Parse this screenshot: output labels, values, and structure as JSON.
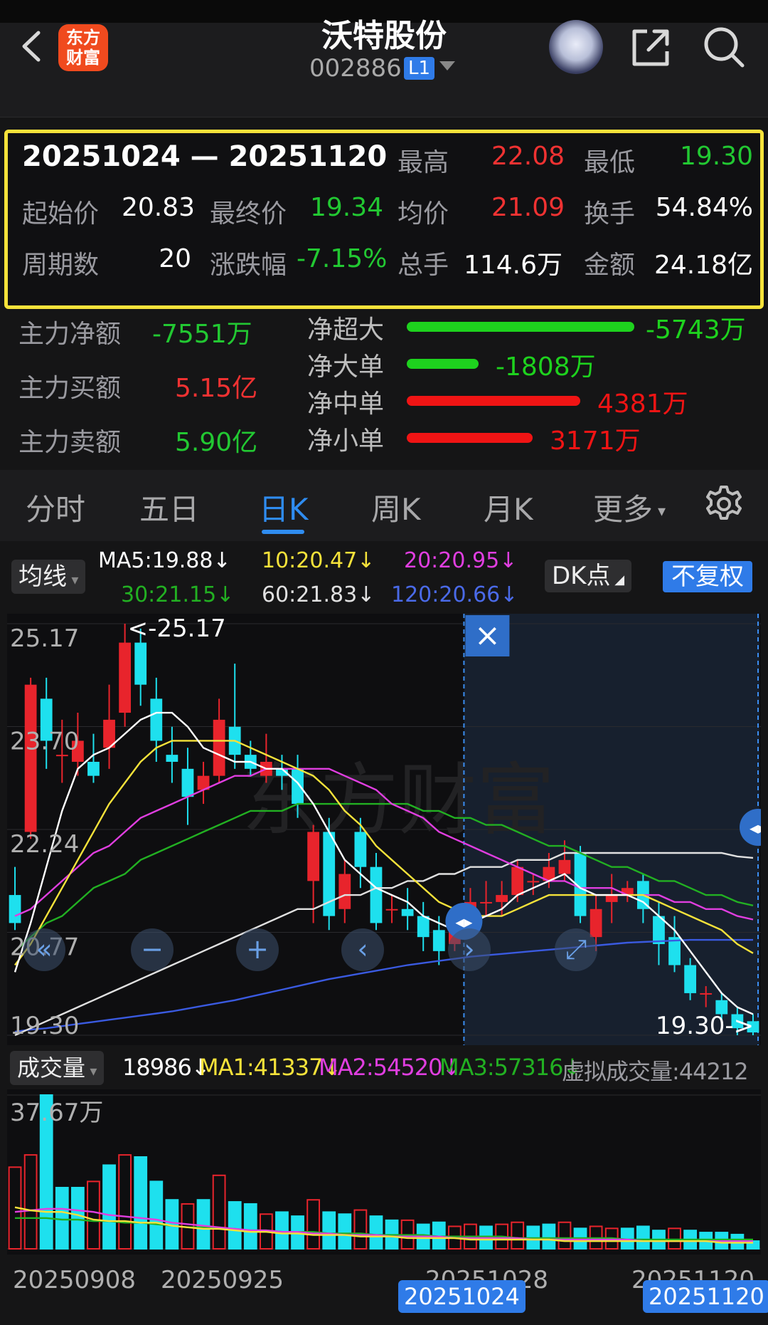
{
  "header": {
    "logo_line1": "东方",
    "logo_line2": "财富",
    "title": "沃特股份",
    "code": "002886",
    "level_badge": "L1"
  },
  "summary": {
    "range": "20251024 — 20251120",
    "high_label": "最高",
    "high": "22.08",
    "low_label": "最低",
    "low": "19.30",
    "open_label": "起始价",
    "open": "20.83",
    "close_label": "最终价",
    "close": "19.34",
    "avg_label": "均价",
    "avg": "21.09",
    "turnover_label": "换手",
    "turnover": "54.84%",
    "periods_label": "周期数",
    "periods": "20",
    "change_label": "涨跌幅",
    "change": "-7.15%",
    "volume_label": "总手",
    "volume": "114.6万",
    "amount_label": "金额",
    "amount": "24.18亿"
  },
  "flow": {
    "main_net_label": "主力净额",
    "main_net": "-7551万",
    "main_buy_label": "主力买额",
    "main_buy": "5.15亿",
    "main_sell_label": "主力卖额",
    "main_sell": "5.90亿",
    "items": [
      {
        "label": "净超大",
        "value": "-5743万",
        "amount": -5743,
        "color": "#1ed21e"
      },
      {
        "label": "净大单",
        "value": "-1808万",
        "amount": -1808,
        "color": "#1ed21e"
      },
      {
        "label": "净中单",
        "value": "4381万",
        "amount": 4381,
        "color": "#f01414"
      },
      {
        "label": "净小单",
        "value": "3171万",
        "amount": 3171,
        "color": "#f01414"
      }
    ]
  },
  "tabs": [
    "分时",
    "五日",
    "日K",
    "周K",
    "月K",
    "更多"
  ],
  "active_tab": "日K",
  "ma_legend": {
    "chip": "均线",
    "ma5": "MA5:19.88↓",
    "ma10": "10:20.47↓",
    "ma20": "20:20.95↓",
    "ma30": "30:21.15↓",
    "ma60": "60:21.83↓",
    "ma120": "120:20.66↓",
    "dk_chip": "DK点",
    "fq_button": "不复权",
    "colors": {
      "ma5": "#ffffff",
      "ma10": "#f5e23a",
      "ma20": "#e03ee0",
      "ma30": "#22b022",
      "ma60": "#e0e0e0",
      "ma120": "#3a5ae0"
    }
  },
  "kline": {
    "y_labels": [
      "25.17",
      "23.70",
      "22.24",
      "20.77",
      "19.30"
    ],
    "max_annotation": "<-25.17",
    "min_annotation": "19.30->",
    "close_icon": "×",
    "ylim": [
      19.3,
      25.17
    ]
  },
  "volume": {
    "chip": "成交量",
    "value": "18986↓",
    "ma1": "MA1:41337↓",
    "ma2": "MA2:54520↓",
    "ma3": "MA3:57316↓",
    "virtual": "虚拟成交量:44212",
    "top_label": "37.67万",
    "max": 376700
  },
  "x_dates": [
    "20250908",
    "20250925",
    "20251028",
    "20251120"
  ],
  "selected_start": "20251024",
  "selected_end": "20251120",
  "chart_data": {
    "type": "candlestick",
    "ylim": [
      19.3,
      25.17
    ],
    "candles": [
      {
        "o": 21.3,
        "c": 20.9,
        "h": 21.7,
        "l": 20.8
      },
      {
        "o": 22.2,
        "c": 24.3,
        "h": 24.4,
        "l": 22.1
      },
      {
        "o": 24.1,
        "c": 23.5,
        "h": 24.4,
        "l": 23.1
      },
      {
        "o": 23.3,
        "c": 23.3,
        "h": 23.8,
        "l": 22.9
      },
      {
        "o": 23.2,
        "c": 23.5,
        "h": 23.9,
        "l": 23.0
      },
      {
        "o": 23.2,
        "c": 23.0,
        "h": 23.6,
        "l": 22.9
      },
      {
        "o": 23.4,
        "c": 23.8,
        "h": 24.3,
        "l": 23.1
      },
      {
        "o": 23.9,
        "c": 24.9,
        "h": 25.17,
        "l": 23.7
      },
      {
        "o": 24.9,
        "c": 24.3,
        "h": 25.1,
        "l": 24.0
      },
      {
        "o": 24.1,
        "c": 23.5,
        "h": 24.4,
        "l": 23.2
      },
      {
        "o": 23.3,
        "c": 23.2,
        "h": 23.7,
        "l": 22.9
      },
      {
        "o": 23.1,
        "c": 22.7,
        "h": 23.4,
        "l": 22.3
      },
      {
        "o": 22.8,
        "c": 23.0,
        "h": 23.2,
        "l": 22.6
      },
      {
        "o": 23.0,
        "c": 23.8,
        "h": 24.1,
        "l": 22.9
      },
      {
        "o": 23.7,
        "c": 23.3,
        "h": 24.6,
        "l": 23.1
      },
      {
        "o": 23.3,
        "c": 23.1,
        "h": 23.5,
        "l": 23.0
      },
      {
        "o": 23.0,
        "c": 23.2,
        "h": 23.6,
        "l": 22.9
      },
      {
        "o": 23.1,
        "c": 23.0,
        "h": 23.3,
        "l": 22.8
      },
      {
        "o": 23.1,
        "c": 22.6,
        "h": 23.3,
        "l": 22.4
      },
      {
        "o": 21.5,
        "c": 22.2,
        "h": 22.3,
        "l": 20.9
      },
      {
        "o": 22.2,
        "c": 21.0,
        "h": 22.4,
        "l": 20.8
      },
      {
        "o": 21.1,
        "c": 21.6,
        "h": 21.8,
        "l": 20.9
      },
      {
        "o": 22.2,
        "c": 21.7,
        "h": 22.4,
        "l": 21.4
      },
      {
        "o": 21.7,
        "c": 20.9,
        "h": 21.9,
        "l": 20.8
      },
      {
        "o": 21.1,
        "c": 21.1,
        "h": 21.3,
        "l": 20.9
      },
      {
        "o": 21.1,
        "c": 21.0,
        "h": 21.4,
        "l": 20.8
      },
      {
        "o": 21.0,
        "c": 20.7,
        "h": 21.2,
        "l": 20.5
      },
      {
        "o": 20.8,
        "c": 20.5,
        "h": 21.0,
        "l": 20.3
      },
      {
        "o": 20.6,
        "c": 20.8,
        "h": 21.0,
        "l": 20.5
      },
      {
        "o": 21.1,
        "c": 21.2,
        "h": 21.4,
        "l": 20.9
      },
      {
        "o": 21.2,
        "c": 21.2,
        "h": 21.5,
        "l": 21.0
      },
      {
        "o": 21.2,
        "c": 21.3,
        "h": 21.5,
        "l": 21.0
      },
      {
        "o": 21.3,
        "c": 21.7,
        "h": 21.8,
        "l": 21.2
      },
      {
        "o": 21.5,
        "c": 21.5,
        "h": 21.6,
        "l": 21.3
      },
      {
        "o": 21.5,
        "c": 21.7,
        "h": 21.9,
        "l": 21.4
      },
      {
        "o": 21.6,
        "c": 21.8,
        "h": 22.08,
        "l": 21.5
      },
      {
        "o": 21.9,
        "c": 21.0,
        "h": 22.0,
        "l": 20.9
      },
      {
        "o": 20.7,
        "c": 21.1,
        "h": 21.3,
        "l": 20.5
      },
      {
        "o": 21.2,
        "c": 21.3,
        "h": 21.6,
        "l": 20.9
      },
      {
        "o": 21.3,
        "c": 21.4,
        "h": 21.5,
        "l": 21.2
      },
      {
        "o": 21.5,
        "c": 21.1,
        "h": 21.6,
        "l": 20.9
      },
      {
        "o": 21.0,
        "c": 20.6,
        "h": 21.2,
        "l": 20.3
      },
      {
        "o": 20.7,
        "c": 20.3,
        "h": 21.0,
        "l": 20.2
      },
      {
        "o": 20.3,
        "c": 19.9,
        "h": 20.4,
        "l": 19.8
      },
      {
        "o": 19.9,
        "c": 19.9,
        "h": 20.0,
        "l": 19.7
      },
      {
        "o": 19.8,
        "c": 19.6,
        "h": 19.9,
        "l": 19.5
      },
      {
        "o": 19.6,
        "c": 19.4,
        "h": 19.7,
        "l": 19.3
      },
      {
        "o": 19.5,
        "c": 19.34,
        "h": 19.6,
        "l": 19.3
      }
    ],
    "ma5": [
      20.2,
      20.9,
      21.7,
      22.5,
      23.1,
      23.3,
      23.4,
      23.6,
      23.8,
      23.9,
      23.9,
      23.7,
      23.4,
      23.3,
      23.2,
      23.2,
      23.1,
      23.1,
      22.9,
      22.6,
      22.2,
      21.8,
      21.6,
      21.4,
      21.3,
      21.2,
      21.0,
      20.9,
      20.8,
      20.9,
      21.0,
      21.1,
      21.3,
      21.4,
      21.5,
      21.6,
      21.4,
      21.3,
      21.3,
      21.3,
      21.2,
      21.0,
      20.8,
      20.5,
      20.2,
      19.9,
      19.7,
      19.6
    ],
    "ma10": [
      20.3,
      20.6,
      21.0,
      21.4,
      21.8,
      22.2,
      22.6,
      22.9,
      23.2,
      23.4,
      23.5,
      23.5,
      23.5,
      23.5,
      23.5,
      23.4,
      23.3,
      23.2,
      23.1,
      23.0,
      22.8,
      22.5,
      22.3,
      22.0,
      21.8,
      21.6,
      21.4,
      21.2,
      21.1,
      21.0,
      21.0,
      21.0,
      21.1,
      21.2,
      21.3,
      21.3,
      21.3,
      21.3,
      21.3,
      21.3,
      21.3,
      21.2,
      21.1,
      21.0,
      20.9,
      20.8,
      20.6,
      20.47
    ],
    "ma20": [
      21.0,
      21.1,
      21.3,
      21.5,
      21.7,
      21.9,
      22.0,
      22.2,
      22.4,
      22.5,
      22.6,
      22.7,
      22.8,
      22.9,
      23.0,
      23.0,
      23.1,
      23.1,
      23.1,
      23.1,
      23.1,
      23.0,
      22.9,
      22.8,
      22.6,
      22.5,
      22.4,
      22.2,
      22.1,
      22.0,
      21.9,
      21.8,
      21.7,
      21.6,
      21.5,
      21.5,
      21.4,
      21.4,
      21.4,
      21.3,
      21.3,
      21.3,
      21.2,
      21.2,
      21.1,
      21.1,
      21.0,
      20.95
    ],
    "ma30": [
      20.5,
      20.7,
      20.9,
      21.0,
      21.2,
      21.4,
      21.5,
      21.6,
      21.8,
      21.9,
      22.0,
      22.1,
      22.2,
      22.3,
      22.4,
      22.5,
      22.5,
      22.5,
      22.6,
      22.6,
      22.6,
      22.6,
      22.6,
      22.6,
      22.6,
      22.6,
      22.5,
      22.5,
      22.4,
      22.4,
      22.3,
      22.3,
      22.2,
      22.1,
      22.0,
      22.0,
      21.9,
      21.8,
      21.7,
      21.7,
      21.6,
      21.5,
      21.5,
      21.4,
      21.3,
      21.3,
      21.2,
      21.15
    ],
    "ma60": [
      19.3,
      19.4,
      19.5,
      19.6,
      19.7,
      19.8,
      19.9,
      20.0,
      20.1,
      20.2,
      20.3,
      20.4,
      20.5,
      20.6,
      20.7,
      20.8,
      20.9,
      21.0,
      21.1,
      21.1,
      21.2,
      21.3,
      21.3,
      21.4,
      21.4,
      21.5,
      21.5,
      21.6,
      21.6,
      21.7,
      21.7,
      21.7,
      21.8,
      21.8,
      21.8,
      21.9,
      21.9,
      21.9,
      21.9,
      21.9,
      21.9,
      21.9,
      21.9,
      21.9,
      21.9,
      21.9,
      21.85,
      21.83
    ],
    "ma120": [
      19.35,
      19.38,
      19.4,
      19.43,
      19.46,
      19.49,
      19.52,
      19.55,
      19.58,
      19.61,
      19.64,
      19.68,
      19.72,
      19.76,
      19.8,
      19.85,
      19.9,
      19.95,
      20.0,
      20.05,
      20.1,
      20.14,
      20.18,
      20.22,
      20.26,
      20.3,
      20.33,
      20.36,
      20.39,
      20.42,
      20.44,
      20.46,
      20.48,
      20.5,
      20.52,
      20.54,
      20.56,
      20.58,
      20.6,
      20.62,
      20.63,
      20.64,
      20.65,
      20.66,
      20.66,
      20.66,
      20.66,
      20.66
    ],
    "volumes": [
      200000,
      230000,
      376700,
      150000,
      150000,
      165000,
      205000,
      230000,
      225000,
      165000,
      120000,
      110000,
      120000,
      180000,
      115000,
      110000,
      85000,
      90000,
      80000,
      120000,
      90000,
      85000,
      95000,
      80000,
      70000,
      70000,
      60000,
      65000,
      55000,
      60000,
      55000,
      60000,
      65000,
      55000,
      60000,
      65000,
      50000,
      55000,
      50000,
      50000,
      55000,
      45000,
      50000,
      45000,
      40000,
      40000,
      35000,
      18986
    ],
    "volume_up": [
      true,
      true,
      false,
      false,
      false,
      true,
      false,
      true,
      false,
      false,
      false,
      true,
      false,
      true,
      false,
      false,
      true,
      false,
      false,
      true,
      false,
      false,
      true,
      false,
      false,
      true,
      false,
      false,
      true,
      true,
      false,
      true,
      true,
      false,
      false,
      true,
      false,
      true,
      true,
      false,
      false,
      false,
      true,
      false,
      false,
      false,
      false,
      false
    ],
    "vol_ma1": [
      0.27,
      0.25,
      0.24,
      0.24,
      0.22,
      0.19,
      0.18,
      0.18,
      0.17,
      0.17,
      0.15,
      0.14,
      0.13,
      0.13,
      0.12,
      0.11,
      0.11,
      0.1,
      0.1,
      0.09,
      0.09,
      0.09,
      0.08,
      0.08,
      0.08,
      0.07,
      0.07,
      0.07,
      0.07,
      0.06,
      0.06,
      0.06,
      0.06,
      0.06,
      0.06,
      0.05,
      0.05,
      0.05,
      0.05,
      0.05,
      0.05,
      0.05,
      0.05,
      0.05,
      0.05,
      0.04,
      0.04,
      0.04
    ],
    "vol_ma2": [
      0.24,
      0.25,
      0.26,
      0.26,
      0.25,
      0.24,
      0.22,
      0.21,
      0.2,
      0.19,
      0.17,
      0.16,
      0.15,
      0.14,
      0.13,
      0.12,
      0.12,
      0.11,
      0.11,
      0.1,
      0.1,
      0.09,
      0.09,
      0.09,
      0.08,
      0.08,
      0.08,
      0.08,
      0.07,
      0.07,
      0.07,
      0.07,
      0.07,
      0.06,
      0.06,
      0.06,
      0.06,
      0.06,
      0.06,
      0.06,
      0.05,
      0.05,
      0.05,
      0.05,
      0.05,
      0.05,
      0.05,
      0.05
    ],
    "vol_ma3": [
      0.2,
      0.2,
      0.2,
      0.19,
      0.19,
      0.18,
      0.18,
      0.17,
      0.17,
      0.16,
      0.15,
      0.14,
      0.14,
      0.13,
      0.13,
      0.12,
      0.12,
      0.11,
      0.11,
      0.11,
      0.1,
      0.1,
      0.1,
      0.09,
      0.09,
      0.09,
      0.09,
      0.08,
      0.08,
      0.08,
      0.08,
      0.08,
      0.07,
      0.07,
      0.07,
      0.07,
      0.07,
      0.07,
      0.07,
      0.06,
      0.06,
      0.06,
      0.06,
      0.06,
      0.06,
      0.06,
      0.06,
      0.06
    ]
  }
}
